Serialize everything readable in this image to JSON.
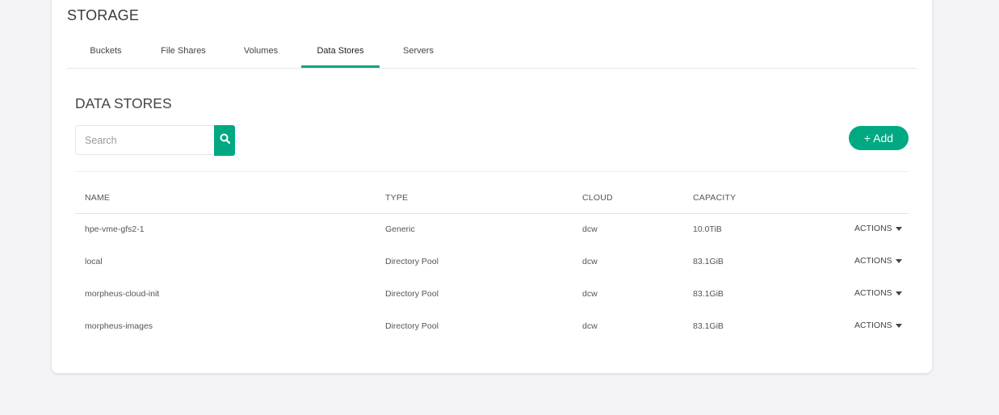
{
  "page": {
    "title": "STORAGE"
  },
  "tabs": [
    {
      "label": "Buckets",
      "active": false
    },
    {
      "label": "File Shares",
      "active": false
    },
    {
      "label": "Volumes",
      "active": false
    },
    {
      "label": "Data Stores",
      "active": true
    },
    {
      "label": "Servers",
      "active": false
    }
  ],
  "section": {
    "title": "DATA STORES"
  },
  "search": {
    "placeholder": "Search",
    "value": ""
  },
  "toolbar": {
    "add_label": "+ Add"
  },
  "table": {
    "columns": [
      "NAME",
      "TYPE",
      "CLOUD",
      "CAPACITY"
    ],
    "actions_label": "ACTIONS",
    "rows": [
      {
        "name": "hpe-vme-gfs2-1",
        "type": "Generic",
        "cloud": "dcw",
        "capacity": "10.0TiB"
      },
      {
        "name": "local",
        "type": "Directory Pool",
        "cloud": "dcw",
        "capacity": "83.1GiB"
      },
      {
        "name": "morpheus-cloud-init",
        "type": "Directory Pool",
        "cloud": "dcw",
        "capacity": "83.1GiB"
      },
      {
        "name": "morpheus-images",
        "type": "Directory Pool",
        "cloud": "dcw",
        "capacity": "83.1GiB"
      }
    ]
  },
  "colors": {
    "accent": "#01a982",
    "background": "#f4f3f6"
  },
  "icons": {
    "search": "search-icon",
    "caret": "caret-down-icon"
  }
}
